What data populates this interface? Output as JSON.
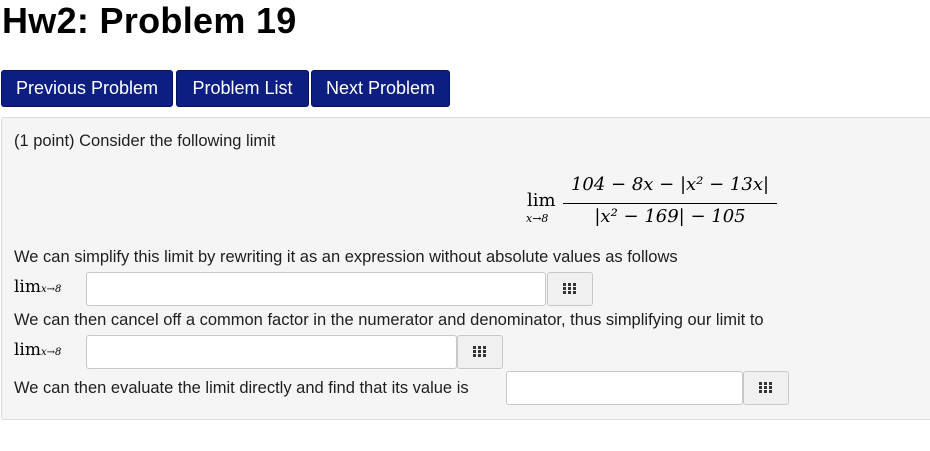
{
  "page": {
    "title": "Hw2: Problem 19"
  },
  "nav": {
    "previous": "Previous Problem",
    "list": "Problem List",
    "next": "Next Problem"
  },
  "problem": {
    "intro": "(1 point) Consider the following limit",
    "limit": {
      "lim": "lim",
      "sub": "x→8",
      "numerator": "104 − 8x − |x² − 13x|",
      "denominator": "|x² − 169| − 105"
    },
    "step1_text": "We can simplify this limit by rewriting it as an expression without absolute values as follows",
    "step1_prefix": "lim",
    "step1_sub": "x→8",
    "step1_value": "",
    "step2_text": "We can then cancel off a common factor in the numerator and denominator, thus simplifying our limit to",
    "step2_prefix": "lim",
    "step2_sub": "x→8",
    "step2_value": "",
    "step3_text": "We can then evaluate the limit directly and find that its value is",
    "step3_value": ""
  },
  "icons": {
    "keypad": "keypad-icon"
  }
}
